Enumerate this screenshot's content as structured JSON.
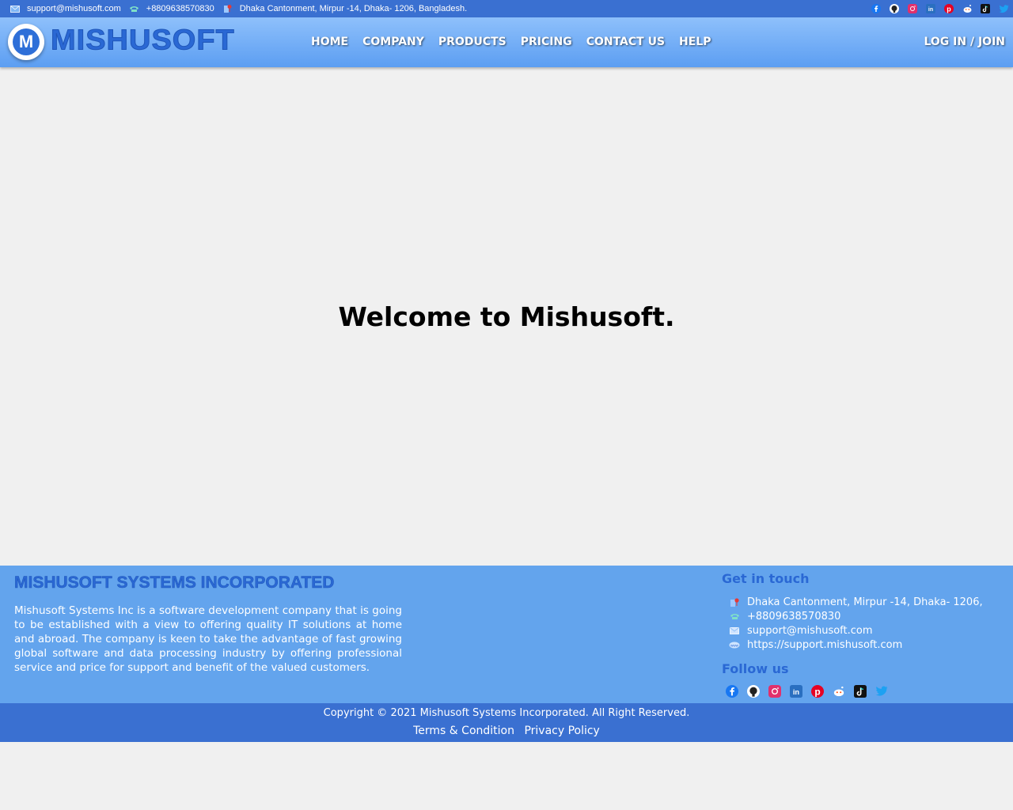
{
  "topbar": {
    "email": "support@mishusoft.com",
    "phone": "+8809638570830",
    "address": "Dhaka Cantonment, Mirpur -14, Dhaka- 1206, Bangladesh.",
    "socials": [
      "facebook-icon",
      "github-icon",
      "instagram-icon",
      "linkedin-icon",
      "pinterest-icon",
      "reddit-icon",
      "tiktok-icon",
      "twitter-icon"
    ]
  },
  "header": {
    "logo_letter": "M",
    "logo_text": "MISHUSOFT",
    "nav": [
      "HOME",
      "COMPANY",
      "PRODUCTS",
      "PRICING",
      "CONTACT US",
      "HELP"
    ],
    "login": "LOG IN / JOIN"
  },
  "main": {
    "welcome": "Welcome to Mishusoft."
  },
  "footer": {
    "title": "MISHUSOFT SYSTEMS INCORPORATED",
    "description": "Mishusoft Systems Inc is a software development company that is going to be established with a view to offering quality IT solutions at home and abroad. The company is keen to take the advantage of fast growing global software and data processing industry by offering professional service and price for support and benefit of the valued customers.",
    "get_in_touch": "Get in touch",
    "contacts": {
      "address": "Dhaka Cantonment, Mirpur -14, Dhaka- 1206,",
      "phone": "+8809638570830",
      "email": "support@mishusoft.com",
      "website": "https://support.mishusoft.com"
    },
    "follow_us": "Follow us"
  },
  "bottom": {
    "copyright": "Copyright © 2021 Mishusoft Systems Incorporated. All Right Reserved.",
    "terms": "Terms & Condition",
    "privacy": "Privacy Policy"
  },
  "colors": {
    "topbar": "#3a70d1",
    "header_top": "#8ec0fb",
    "header_bottom": "#5c9ef2",
    "brand": "#2a68d4",
    "footer": "#63a4ed",
    "background": "#f0f0f0"
  }
}
